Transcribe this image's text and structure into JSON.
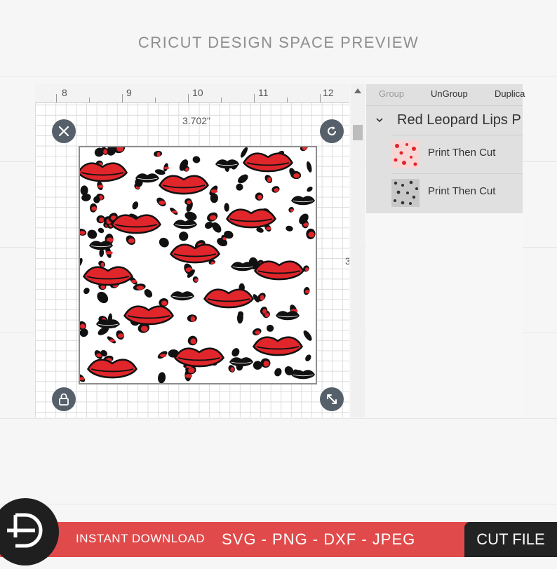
{
  "title": "CRICUT DESIGN SPACE PREVIEW",
  "ruler": {
    "numbers": [
      "8",
      "9",
      "10",
      "11",
      "12"
    ]
  },
  "canvas": {
    "width_label": "3.702\"",
    "height_label": "3"
  },
  "controls": {
    "close_icon": "close-icon",
    "rotate_icon": "rotate-icon",
    "lock_icon": "lock-icon",
    "resize_icon": "resize-icon"
  },
  "panel": {
    "toolbar": {
      "group": "Group",
      "ungroup": "UnGroup",
      "duplicate": "Duplica"
    },
    "layer_group_name": "Red Leopard Lips P",
    "layers": [
      {
        "label": "Print Then Cut"
      },
      {
        "label": "Print Then Cut"
      }
    ]
  },
  "footer": {
    "instant_download": "INSTANT DOWNLOAD",
    "formats": "SVG - PNG - DXF - JPEG",
    "cut_file": "CUT FILE"
  },
  "colors": {
    "accent": "#e14a4a",
    "lips_red": "#e0262b",
    "dark": "#232323"
  }
}
